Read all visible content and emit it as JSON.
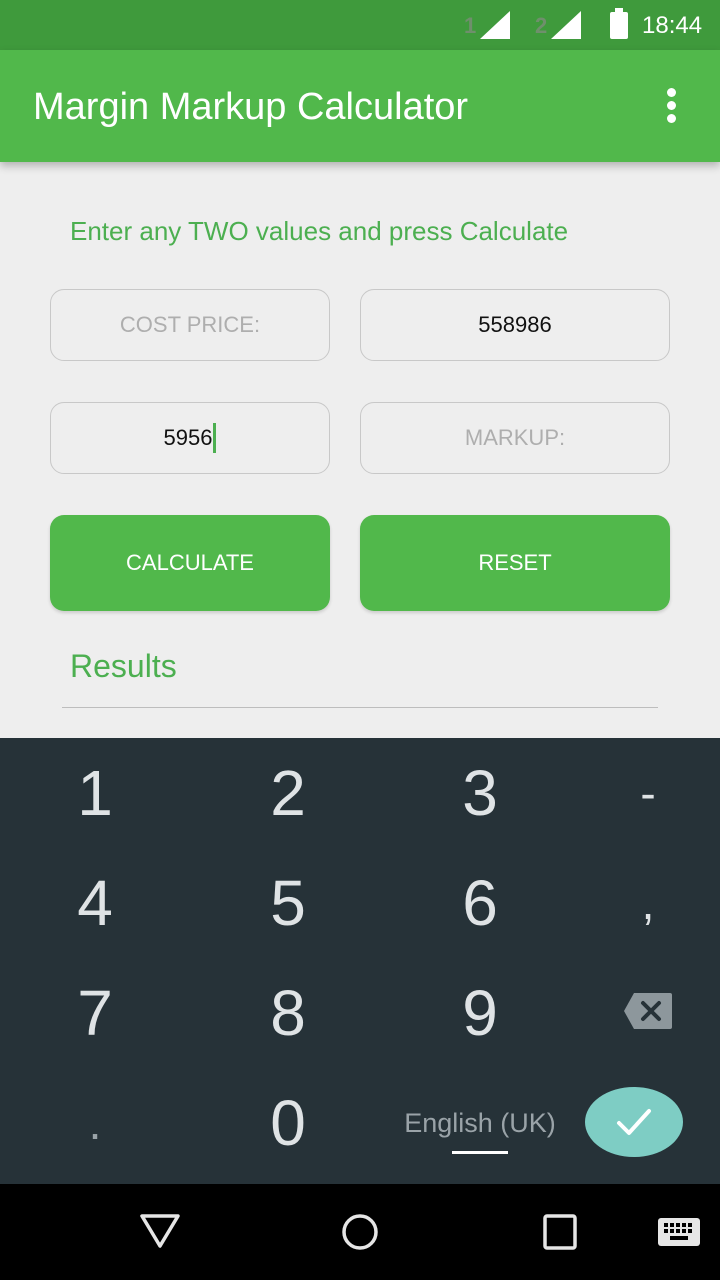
{
  "status_bar": {
    "sim1_label": "1",
    "sim2_label": "2",
    "time": "18:44",
    "icons": [
      "signal-sim1-icon",
      "signal-sim2-icon",
      "battery-icon"
    ]
  },
  "app_bar": {
    "title": "Margin Markup Calculator",
    "menu_icon": "overflow-menu-icon"
  },
  "form": {
    "instruction": "Enter any TWO values and press Calculate",
    "fields": [
      {
        "name": "cost-price",
        "value": "",
        "placeholder": "COST PRICE:"
      },
      {
        "name": "selling-price",
        "value": "558986",
        "placeholder": ""
      },
      {
        "name": "margin",
        "value": "5956",
        "placeholder": ""
      },
      {
        "name": "markup",
        "value": "",
        "placeholder": "MARKUP:"
      }
    ],
    "calculate_label": "CALCULATE",
    "reset_label": "RESET",
    "results_heading": "Results"
  },
  "keyboard": {
    "keys": [
      [
        "1",
        "2",
        "3",
        "-"
      ],
      [
        "4",
        "5",
        "6",
        ","
      ],
      [
        "7",
        "8",
        "9",
        "backspace"
      ],
      [
        ".",
        "0",
        "English (UK)",
        "done"
      ]
    ],
    "language_label": "English (UK)",
    "accent_color": "#7ecdc4"
  },
  "nav_bar": {
    "icons": [
      "back-icon",
      "home-icon",
      "recents-icon",
      "keyboard-switch-icon"
    ]
  },
  "colors": {
    "primary": "#51b84b",
    "status_bar": "#3f9a3c",
    "keyboard_bg": "#263238"
  }
}
